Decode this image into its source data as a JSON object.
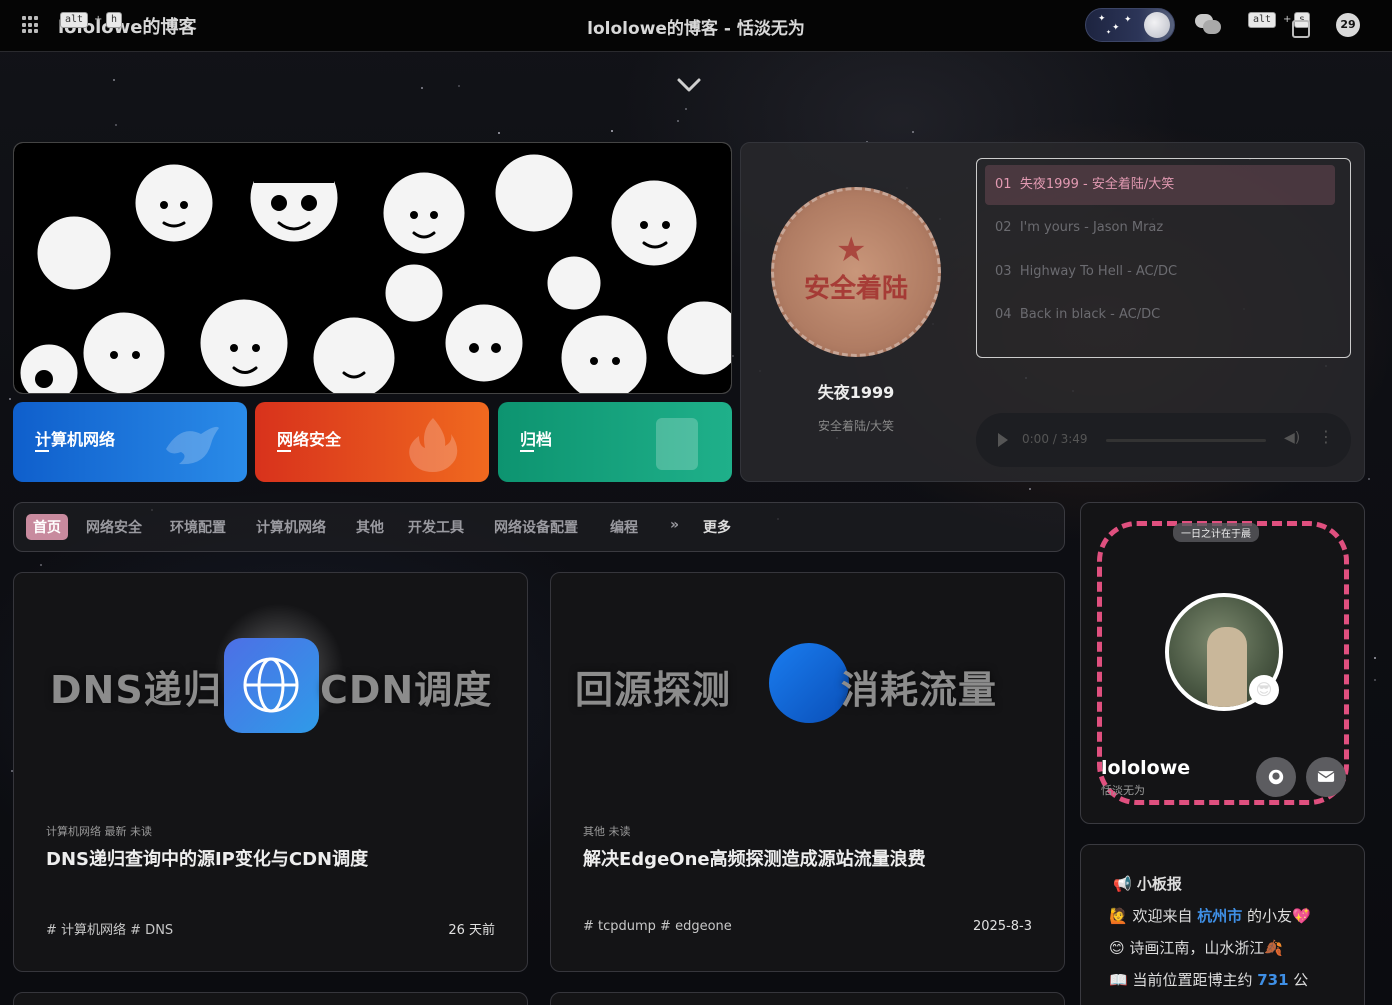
{
  "header": {
    "site_name": "lololowe的博客",
    "page_title": "lololowe的博客 - 恬淡无为",
    "kbd_alt": "alt",
    "kbd_h": "h",
    "kbd_alt2": "alt",
    "kbd_s": "s",
    "plus": "+",
    "badge_count": "29",
    "icons": [
      "apps-grid-icon",
      "moon-icon",
      "chat-icon",
      "search-icon"
    ]
  },
  "categories": [
    {
      "label": "计算机网络",
      "color": "#1a6fd6",
      "icon": "bird-icon"
    },
    {
      "label": "网络安全",
      "color": "#e9451e",
      "icon": "fire-icon"
    },
    {
      "label": "归档",
      "color": "#16a17e",
      "icon": "book-icon"
    }
  ],
  "music": {
    "now_playing_title": "失夜1999",
    "now_playing_artist": "安全着陆/大笑",
    "cover_text": "安全着陆",
    "playlist": [
      {
        "num": "01",
        "text": "失夜1999 - 安全着陆/大笑"
      },
      {
        "num": "02",
        "text": "I'm yours - Jason Mraz"
      },
      {
        "num": "03",
        "text": "Highway To Hell - AC/DC"
      },
      {
        "num": "04",
        "text": "Back in black - AC/DC"
      }
    ],
    "time": "0:00 / 3:49"
  },
  "nav": {
    "items": [
      "首页",
      "网络安全",
      "环境配置",
      "计算机网络",
      "其他",
      "开发工具",
      "网络设备配置",
      "编程"
    ],
    "more_label": "更多",
    "more_icon": "»"
  },
  "posts": [
    {
      "cover_left": "DNS递归",
      "cover_right": "CDN调度",
      "meta": "计算机网络  最新  未读",
      "title": "DNS递归查询中的源IP变化与CDN调度",
      "tags": "# 计算机网络  # DNS",
      "date": "26 天前"
    },
    {
      "cover_left": "回源探测",
      "cover_right": "消耗流量",
      "meta": "其他  未读",
      "title": "解决EdgeOne高频探测造成源站流量浪费",
      "tags": "# tcpdump  # edgeone",
      "date": "2025-8-3"
    }
  ],
  "profile": {
    "motto": "一日之计在于晨",
    "name": "lololowe",
    "subtitle": "恬淡无为",
    "emoji": "😎",
    "github_icon": "github-icon",
    "mail_icon": "mail-icon"
  },
  "notice": {
    "title": "📢 小板报",
    "line1_a": "🙋 欢迎来自 ",
    "line1_city": "杭州市",
    "line1_b": " 的小友💖",
    "line2": "😊 诗画江南，山水浙江🍂",
    "line3_a": "📖 当前位置距博主约 ",
    "line3_num": "731",
    "line3_b": " 公"
  }
}
